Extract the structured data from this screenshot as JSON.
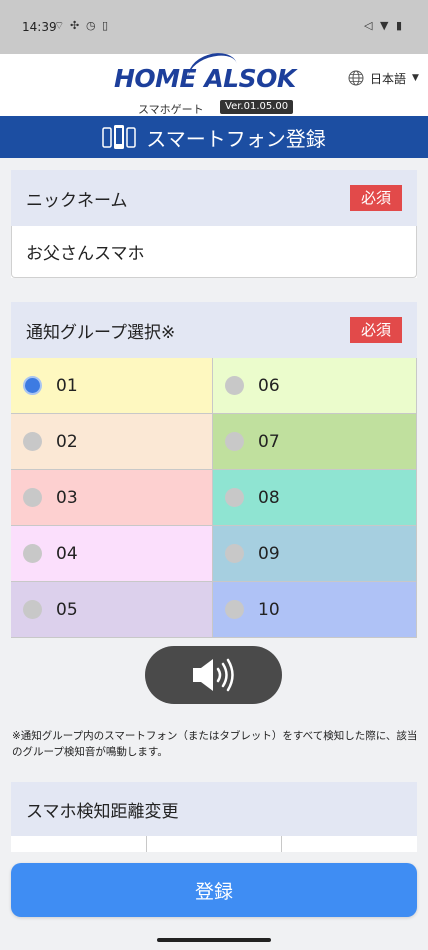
{
  "status_bar": {
    "time": "14:39",
    "icons": [
      "wifi-calling-icon",
      "fan-icon",
      "timer-icon",
      "sim-icon",
      "mute-icon",
      "wifi-icon",
      "battery-icon"
    ]
  },
  "header": {
    "logo_text": "HOME ALSOK",
    "subtitle": "スマホゲート",
    "version": "Ver.01.05.00",
    "language": "日本語"
  },
  "title_bar": {
    "title": "スマートフォン登録"
  },
  "nickname": {
    "label": "ニックネーム",
    "required": "必須",
    "value": "お父さんスマホ"
  },
  "group_select": {
    "label": "通知グループ選択※",
    "required": "必須",
    "selected": "01",
    "groups": [
      {
        "label": "01",
        "color": "#fef8c0",
        "checked": true
      },
      {
        "label": "06",
        "color": "#ebfccc",
        "checked": false
      },
      {
        "label": "02",
        "color": "#fbe8d5",
        "checked": false
      },
      {
        "label": "07",
        "color": "#c0e09e",
        "checked": false
      },
      {
        "label": "03",
        "color": "#fdd0d0",
        "checked": false
      },
      {
        "label": "08",
        "color": "#8fe4d2",
        "checked": false
      },
      {
        "label": "04",
        "color": "#fbdffc",
        "checked": false
      },
      {
        "label": "09",
        "color": "#a6cfe0",
        "checked": false
      },
      {
        "label": "05",
        "color": "#dcd0ec",
        "checked": false
      },
      {
        "label": "10",
        "color": "#afc2f6",
        "checked": false
      }
    ]
  },
  "note": "※通知グループ内のスマートフォン（またはタブレット）をすべて検知した際に、該当のグループ検知音が鳴動します。",
  "distance": {
    "label": "スマホ検知距離変更"
  },
  "footer": {
    "register_label": "登録"
  },
  "colors": {
    "brand_blue": "#1c4ea2",
    "button_blue": "#3f8df3",
    "required_red": "#e24a4a",
    "radio_checked": "#3d7be2"
  }
}
